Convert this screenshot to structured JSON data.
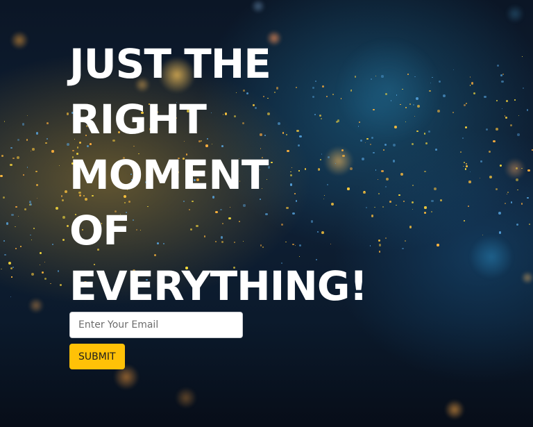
{
  "hero": {
    "headline_lines": [
      "JUST THE",
      "RIGHT",
      "MOMENT",
      "OF",
      "EVERYTHING!"
    ]
  },
  "form": {
    "email_placeholder": "Enter Your Email",
    "submit_label": "SUBMIT"
  },
  "colors": {
    "accent": "#ffc107",
    "headline": "#ffffff",
    "input_border": "#c9ccd1"
  }
}
